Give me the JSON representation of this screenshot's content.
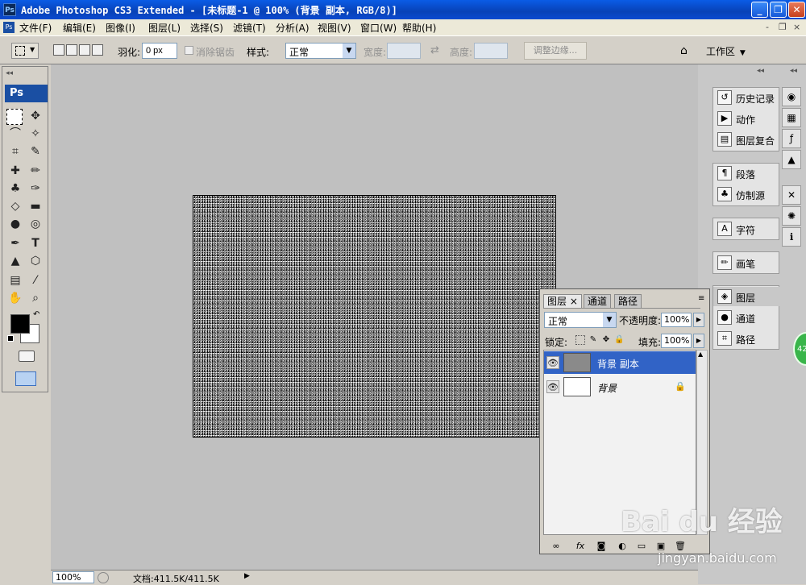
{
  "window": {
    "app_badge": "Ps",
    "title": "Adobe Photoshop CS3 Extended - [未标题-1 @ 100% (背景 副本, RGB/8)]",
    "minimize": "_",
    "restore": "❐",
    "close": "✕"
  },
  "menubar": {
    "items": [
      "文件(F)",
      "编辑(E)",
      "图像(I)",
      "图层(L)",
      "选择(S)",
      "滤镜(T)",
      "分析(A)",
      "视图(V)",
      "窗口(W)",
      "帮助(H)"
    ],
    "doc_controls": [
      "-",
      "❐",
      "×"
    ]
  },
  "options_bar": {
    "feather_label": "羽化:",
    "feather_value": "0 px",
    "antialias_label": "消除锯齿",
    "style_label": "样式:",
    "style_value": "正常",
    "width_label": "宽度:",
    "height_label": "高度:",
    "refine_edge_label": "调整边缘...",
    "workspace_label": "工作区"
  },
  "tools": {
    "logo": "Ps",
    "collapse": "◂◂"
  },
  "status_bar": {
    "zoom": "100%",
    "doc_info": "文档:411.5K/411.5K",
    "arrow": "▶"
  },
  "dock": {
    "collapse": "◂◂",
    "group1": [
      "历史记录",
      "动作",
      "图层复合"
    ],
    "group2": [
      "段落",
      "仿制源"
    ],
    "group3": [
      "字符"
    ],
    "group4": [
      "画笔"
    ],
    "group5": [
      "图层",
      "通道",
      "路径"
    ]
  },
  "layers_panel": {
    "tabs": [
      "图层 ×",
      "通道",
      "路径"
    ],
    "blend_mode": "正常",
    "opacity_label": "不透明度:",
    "opacity_value": "100%",
    "lock_label": "锁定:",
    "fill_label": "填充:",
    "fill_value": "100%",
    "layers": [
      {
        "name": "背景 副本",
        "selected": true
      },
      {
        "name": "背景",
        "selected": false
      }
    ]
  },
  "watermark": {
    "text": "Bai du 经验",
    "url": "jingyan.baidu.com"
  },
  "badge": "42"
}
